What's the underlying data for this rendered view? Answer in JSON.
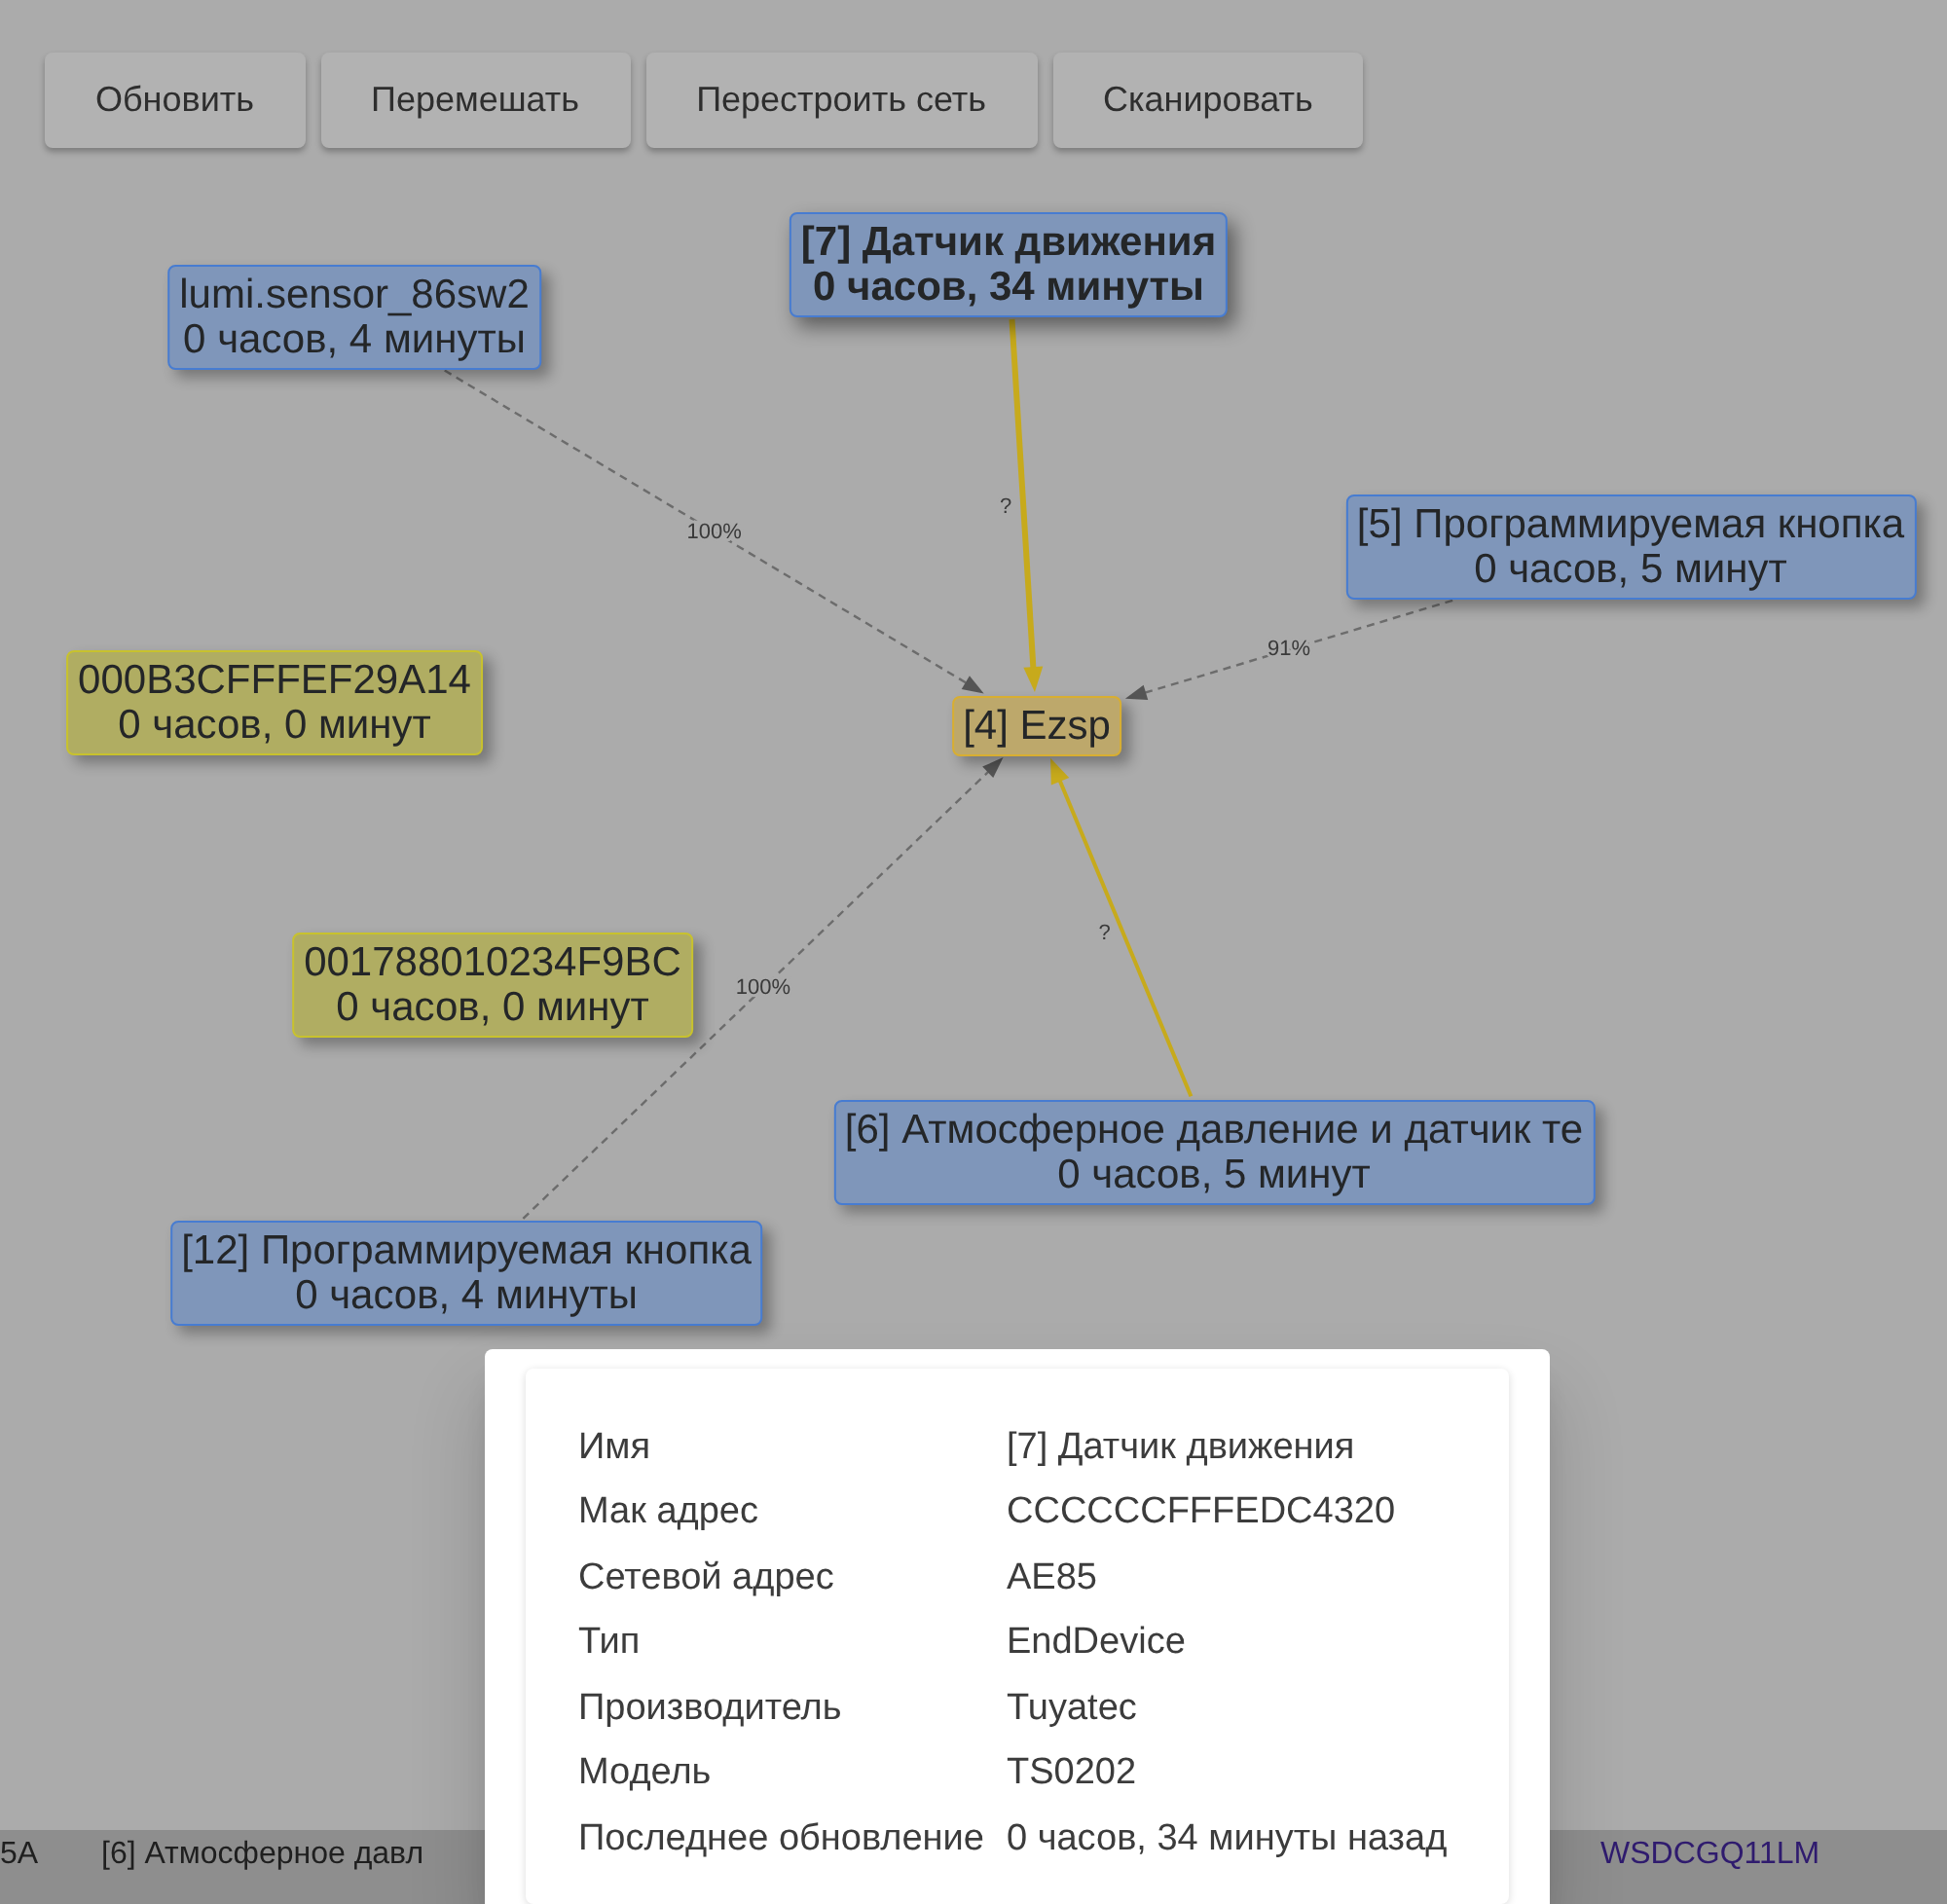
{
  "toolbar": {
    "buttons": [
      "Обновить",
      "Перемешать",
      "Перестроить сеть",
      "Сканировать"
    ]
  },
  "network_map": {
    "coordinator": {
      "name": "[4] Ezsp",
      "color": "#bda86b",
      "selected": false
    },
    "devices": [
      {
        "name": "[7] Датчик движения",
        "time": "0 часов, 34 минуты",
        "color": "#7f96ba",
        "selected": true,
        "link": {
          "kind": "solid",
          "label": "?"
        }
      },
      {
        "name": "lumi.sensor_86sw2",
        "time": "0 часов, 4 минуты",
        "color": "#7f96ba",
        "selected": false,
        "link": {
          "kind": "dashed",
          "label": "100%"
        }
      },
      {
        "name": "[5] Программируемая кнопка",
        "time": "0 часов, 5 минут",
        "color": "#7f96ba",
        "selected": false,
        "link": {
          "kind": "dashed",
          "label": "91%"
        }
      },
      {
        "name": "000B3CFFFEF29A14",
        "time": "0 часов, 0 минут",
        "color": "#b0ad62",
        "selected": false
      },
      {
        "name": "001788010234F9BC",
        "time": "0 часов, 0 минут",
        "color": "#b0ad62",
        "selected": false
      },
      {
        "name": "[6] Атмосферное давление и датчик те",
        "time": "0 часов, 5 минут",
        "color": "#7f96ba",
        "selected": false,
        "link": {
          "kind": "solid",
          "label": "?"
        }
      },
      {
        "name": "[12] Программируемая кнопка",
        "time": "0 часов, 4 минуты",
        "color": "#7f96ba",
        "selected": false,
        "link": {
          "kind": "dashed",
          "label": "100%"
        }
      }
    ]
  },
  "table_row": {
    "cells": [
      {
        "kind": "text",
        "text": "5A"
      },
      {
        "kind": "text",
        "text": "[6] Атмосферное давл"
      },
      {
        "kind": "link",
        "text": "WSDCGQ11LM"
      }
    ]
  },
  "device_dialog": {
    "rows": [
      {
        "label": "Имя",
        "value": "[7] Датчик движения"
      },
      {
        "label": "Мак адрес",
        "value": "CCCCCCFFFEDC4320"
      },
      {
        "label": "Сетевой адрес",
        "value": "AE85"
      },
      {
        "label": "Тип",
        "value": "EndDevice"
      },
      {
        "label": "Производитель",
        "value": "Tuyatec"
      },
      {
        "label": "Модель",
        "value": "TS0202"
      },
      {
        "label": "Последнее обновление",
        "value": "0 часов, 34 минуты назад"
      }
    ]
  }
}
